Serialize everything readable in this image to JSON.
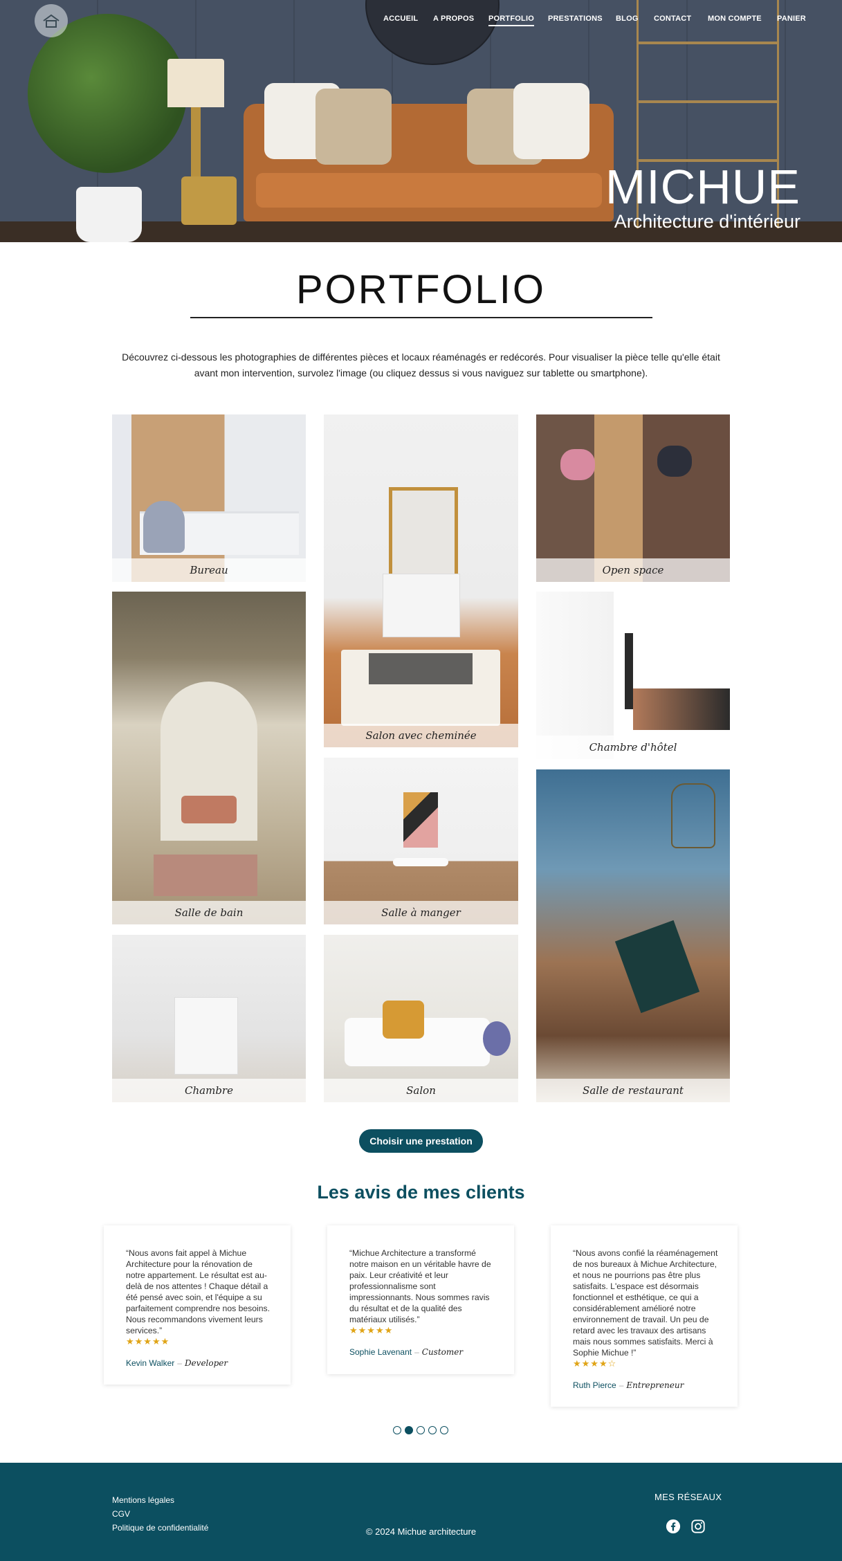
{
  "nav": {
    "items": [
      {
        "label": "ACCUEIL"
      },
      {
        "label": "A PROPOS"
      },
      {
        "label": "PORTFOLIO"
      },
      {
        "label": "PRESTATIONS"
      },
      {
        "label": "BLOG"
      },
      {
        "label": "CONTACT"
      },
      {
        "label": "MON COMPTE"
      },
      {
        "label": "PANIER"
      }
    ],
    "active": "PORTFOLIO"
  },
  "hero": {
    "title": "MICHUE",
    "subtitle": "Architecture d'intérieur"
  },
  "portfolio": {
    "title": "PORTFOLIO",
    "intro": "Découvrez ci-dessous les photographies de différentes pièces et locaux réaménagés er redécorés. Pour visualiser la pièce telle qu'elle était avant mon intervention, survolez l'image (ou cliquez dessus si vous naviguez sur tablette ou smartphone).",
    "items": [
      {
        "caption": "Bureau"
      },
      {
        "caption": "Salon avec cheminée"
      },
      {
        "caption": "Open space"
      },
      {
        "caption": "Salle de bain"
      },
      {
        "caption": "Chambre d'hôtel"
      },
      {
        "caption": "Salle à manger"
      },
      {
        "caption": "Salle de restaurant"
      },
      {
        "caption": "Chambre"
      },
      {
        "caption": "Salon"
      }
    ],
    "cta": "Choisir une prestation"
  },
  "reviews": {
    "title": "Les avis de mes clients",
    "items": [
      {
        "quote": "“Nous avons fait appel à Michue Architecture pour la rénovation de notre appartement. Le résultat est au-delà de nos attentes ! Chaque détail a été pensé avec soin, et l'équipe a su parfaitement comprendre nos besoins. Nous recommandons vivement leurs services.”",
        "stars": "★★★★★",
        "rating": 5,
        "name": "Kevin Walker",
        "role": "Developer"
      },
      {
        "quote": "“Michue Architecture a transformé notre maison en un véritable havre de paix. Leur créativité et leur professionnalisme sont impressionnants. Nous sommes ravis du résultat et de la qualité des matériaux utilisés.”",
        "stars": "★★★★★",
        "rating": 5,
        "name": "Sophie Lavenant",
        "role": "Customer"
      },
      {
        "quote": "“Nous avons confié la réaménagement de nos bureaux à Michue Architecture, et nous ne pourrions pas être plus satisfaits. L'espace est désormais fonctionnel et esthétique, ce qui a considérablement amélioré notre environnement de travail. Un peu de retard avec les travaux des artisans mais nous sommes satisfaits. Merci à Sophie Michue !”",
        "stars": "★★★★☆",
        "rating": 4,
        "name": "Ruth Pierce",
        "role": "Entrepreneur"
      }
    ],
    "carousel": {
      "pages": 5,
      "current": 2
    },
    "separator": "–"
  },
  "footer": {
    "links": [
      "Mentions légales",
      "CGV",
      "Politique de confidentialité"
    ],
    "copyright": "© 2024 Michue architecture",
    "social_title": "MES RÉSEAUX",
    "social": [
      "facebook-icon",
      "instagram-icon"
    ]
  },
  "colors": {
    "accent": "#0c4f60",
    "star": "#e0a416",
    "footer_bg": "#0c4f60"
  }
}
